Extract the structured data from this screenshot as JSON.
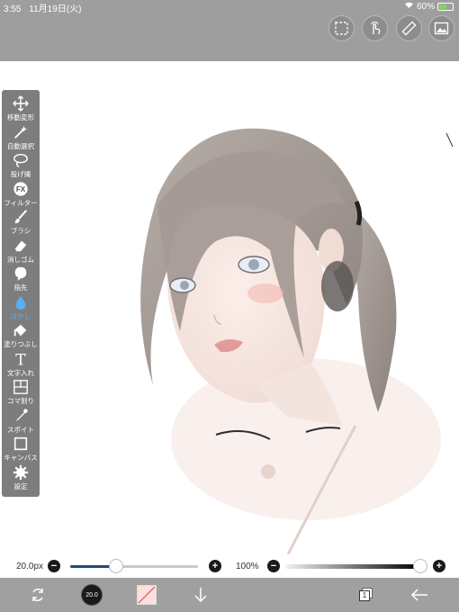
{
  "status": {
    "time": "3:55",
    "date": "11月19日(火)",
    "battery": "60%",
    "battery_level": 0.6
  },
  "top_tools": [
    "selection-icon",
    "hand-touch-icon",
    "ruler-icon",
    "image-icon"
  ],
  "tools": [
    {
      "label": "移動変形",
      "icon": "move-transform-icon"
    },
    {
      "label": "自動選択",
      "icon": "magic-wand-icon"
    },
    {
      "label": "投げ縄",
      "icon": "lasso-icon"
    },
    {
      "label": "フィルター",
      "icon": "fx-filter-icon"
    },
    {
      "label": "ブラシ",
      "icon": "brush-icon"
    },
    {
      "label": "消しゴム",
      "icon": "eraser-icon"
    },
    {
      "label": "指先",
      "icon": "finger-smudge-icon"
    },
    {
      "label": "ぼかし",
      "icon": "blur-drop-icon",
      "active": true
    },
    {
      "label": "塗りつぶし",
      "icon": "fill-bucket-icon"
    },
    {
      "label": "文字入れ",
      "icon": "text-tool-icon"
    },
    {
      "label": "コマ割り",
      "icon": "panel-divide-icon"
    },
    {
      "label": "スポイト",
      "icon": "eyedropper-icon"
    },
    {
      "label": "キャンバス",
      "icon": "canvas-icon"
    },
    {
      "label": "設定",
      "icon": "settings-gear-icon"
    }
  ],
  "brush": {
    "size_label": "20.0px",
    "size_fraction": 0.36
  },
  "opacity": {
    "label": "100%",
    "value_fraction": 1.0
  },
  "bottom": {
    "brush_size_badge": "20.0",
    "layer_count": "1"
  },
  "colors": {
    "active": "#5ab0f0",
    "slider_fill": "#1f4a75"
  }
}
